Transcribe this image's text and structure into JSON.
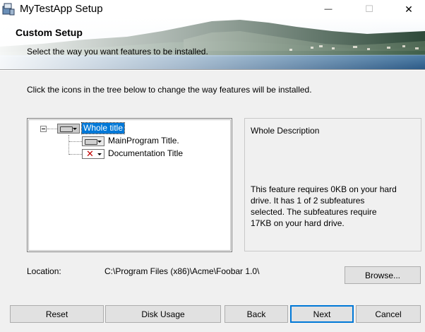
{
  "window": {
    "title": "MyTestApp Setup",
    "minimize_glyph": "—",
    "maximize_glyph": "☐",
    "close_glyph": "✕"
  },
  "banner": {
    "title": "Custom Setup",
    "subtitle": "Select the way you want features to be installed."
  },
  "instruction": "Click the icons in the tree below to change the way features will be installed.",
  "tree": {
    "items": [
      {
        "label": "Whole title",
        "state": "will-be-installed",
        "selected": true
      },
      {
        "label": "MainProgram Title.",
        "state": "will-be-installed",
        "selected": false
      },
      {
        "label": "Documentation Title",
        "state": "not-available",
        "selected": false
      }
    ]
  },
  "description": {
    "title": "Whole Description",
    "body": "This feature requires 0KB on your hard drive. It has 1 of 2 subfeatures selected. The subfeatures require 17KB on your hard drive."
  },
  "location": {
    "label": "Location:",
    "value": "C:\\Program Files (x86)\\Acme\\Foobar 1.0\\"
  },
  "buttons": {
    "browse": "Browse...",
    "reset": "Reset",
    "disk_usage": "Disk Usage",
    "back": "Back",
    "next": "Next",
    "cancel": "Cancel"
  },
  "colors": {
    "selection": "#0078d7",
    "dialog_bg": "#f0f0f0",
    "not_available_x": "#c00000"
  }
}
